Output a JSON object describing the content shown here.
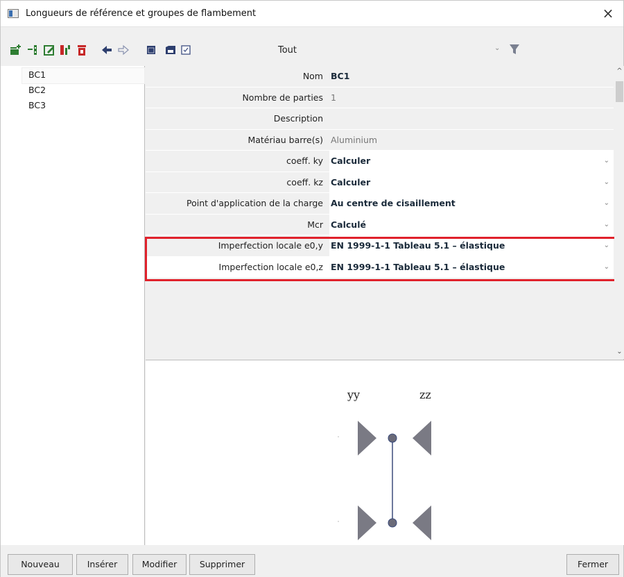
{
  "window": {
    "title": "Longueurs de référence et groupes de flambement",
    "close_glyph": "×"
  },
  "toolbar": {
    "icons": [
      "new-item-icon",
      "insert-item-icon",
      "edit-item-icon",
      "copy-item-icon",
      "delete-item-icon",
      "undo-icon",
      "redo-icon",
      "view-icon",
      "save-icon",
      "checkbox-icon"
    ],
    "filter_value": "Tout",
    "filter_chevron": "⌄"
  },
  "list": {
    "items": [
      "BC1",
      "BC2",
      "BC3"
    ],
    "selected": "BC1"
  },
  "properties": [
    {
      "label": "Nom",
      "value": "BC1",
      "kind": "editable"
    },
    {
      "label": "Nombre de parties",
      "value": "1",
      "kind": "readonly"
    },
    {
      "label": "Description",
      "value": "",
      "kind": "editable"
    },
    {
      "label": "Matériau barre(s)",
      "value": "Aluminium",
      "kind": "readonly"
    },
    {
      "label": "coeff. ky",
      "value": "Calculer",
      "kind": "dropdown"
    },
    {
      "label": "coeff. kz",
      "value": "Calculer",
      "kind": "dropdown"
    },
    {
      "label": "Point d'application de la charge",
      "value": "Au centre de cisaillement",
      "kind": "dropdown"
    },
    {
      "label": "Mcr",
      "value": "Calculé",
      "kind": "dropdown"
    },
    {
      "label": "Imperfection locale e0,y",
      "value": "EN 1999-1-1 Tableau 5.1 – élastique",
      "kind": "dropdown"
    },
    {
      "label": "Imperfection locale e0,z",
      "value": "EN 1999-1-1 Tableau 5.1 – élastique",
      "kind": "dropdown"
    }
  ],
  "preview": {
    "label_yy": "yy",
    "label_zz": "zz"
  },
  "buttons": {
    "new": "Nouveau",
    "insert": "Insérer",
    "modify": "Modifier",
    "delete": "Supprimer",
    "close": "Fermer"
  },
  "colors": {
    "highlight": "#e0212b",
    "support": "#7a7a84",
    "member": "#3a4a7a"
  }
}
